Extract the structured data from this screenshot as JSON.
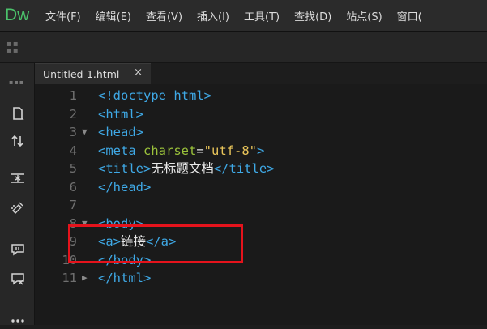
{
  "app": {
    "logo": "Dw"
  },
  "menu": [
    "文件(F)",
    "编辑(E)",
    "查看(V)",
    "插入(I)",
    "工具(T)",
    "查找(D)",
    "站点(S)",
    "窗口("
  ],
  "tab": {
    "label": "Untitled-1.html",
    "close": "×"
  },
  "lines": [
    {
      "num": "1",
      "fold": "",
      "tokens": [
        [
          "tag",
          "<!doctype html>"
        ]
      ]
    },
    {
      "num": "2",
      "fold": "",
      "tokens": [
        [
          "tag",
          "<html>"
        ]
      ]
    },
    {
      "num": "3",
      "fold": "▼",
      "tokens": [
        [
          "tag",
          "<head>"
        ]
      ]
    },
    {
      "num": "4",
      "fold": "",
      "tokens": [
        [
          "tag",
          "<meta "
        ],
        [
          "attr",
          "charset"
        ],
        [
          "plain",
          "="
        ],
        [
          "str",
          "\"utf-8\""
        ],
        [
          "tag",
          ">"
        ]
      ]
    },
    {
      "num": "5",
      "fold": "",
      "tokens": [
        [
          "tag",
          "<title>"
        ],
        [
          "plain",
          "无标题文档"
        ],
        [
          "tag",
          "</title>"
        ]
      ]
    },
    {
      "num": "6",
      "fold": "",
      "tokens": [
        [
          "tag",
          "</head>"
        ]
      ]
    },
    {
      "num": "7",
      "fold": "",
      "tokens": []
    },
    {
      "num": "8",
      "fold": "▼",
      "tokens": [
        [
          "tag",
          "<body>"
        ]
      ]
    },
    {
      "num": "9",
      "fold": "",
      "tokens": [
        [
          "tag",
          "<a>"
        ],
        [
          "plain",
          "链接"
        ],
        [
          "tag",
          "</a>"
        ]
      ],
      "cursor": true
    },
    {
      "num": "10",
      "fold": "",
      "tokens": [
        [
          "tag",
          "</body>"
        ]
      ]
    },
    {
      "num": "11",
      "fold": "▶",
      "tokens": [
        [
          "tag",
          "</html>"
        ]
      ],
      "cursor": true
    }
  ],
  "colors": {
    "tag": "#3fa9e6",
    "attr": "#9bc23b",
    "string": "#e9c55a",
    "highlight": "#e5131c",
    "logo": "#4bc26b"
  }
}
